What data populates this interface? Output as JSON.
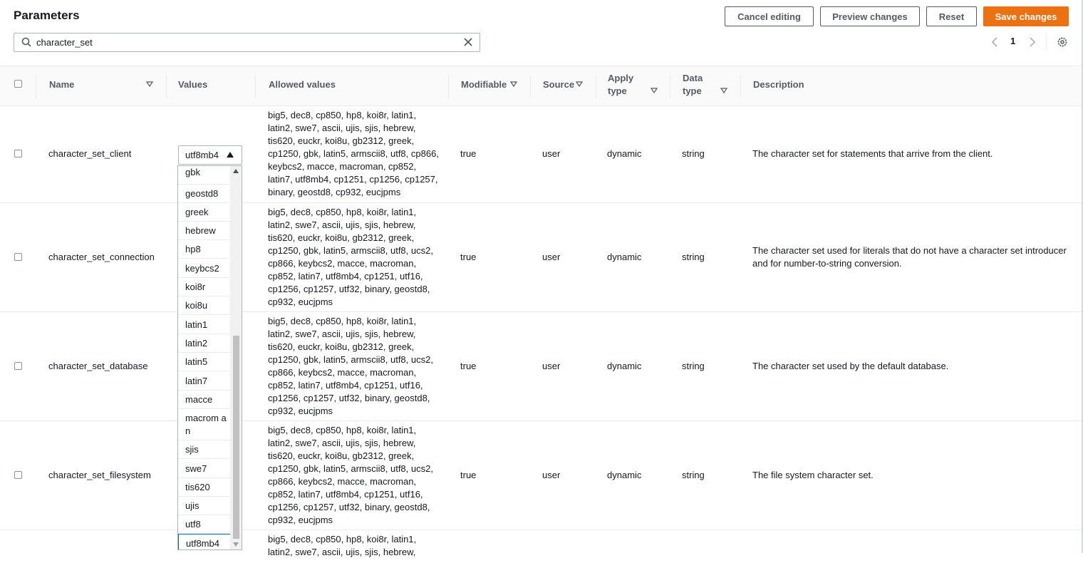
{
  "header": {
    "title": "Parameters",
    "buttons": {
      "cancel": "Cancel editing",
      "preview": "Preview changes",
      "reset": "Reset",
      "save": "Save changes"
    }
  },
  "search": {
    "value": "character_set"
  },
  "pagination": {
    "page": "1"
  },
  "columns": {
    "name": "Name",
    "values": "Values",
    "allowed": "Allowed values",
    "modifiable": "Modifiable",
    "source": "Source",
    "apply_type": "Apply\ntype",
    "data_type": "Data\ntype",
    "description": "Description"
  },
  "rows": [
    {
      "name": "character_set_client",
      "allowed": "big5, dec8, cp850, hp8, koi8r, latin1, latin2, swe7, ascii, ujis, sjis, hebrew, tis620, euckr, koi8u, gb2312, greek, cp1250, gbk, latin5, armscii8, utf8, cp866, keybcs2, macce, macroman, cp852, latin7, utf8mb4, cp1251, cp1256, cp1257, binary, geostd8, cp932, eucjpms",
      "modifiable": "true",
      "source": "user",
      "apply_type": "dynamic",
      "data_type": "string",
      "description": "The character set for statements that arrive from the client."
    },
    {
      "name": "character_set_connection",
      "allowed": "big5, dec8, cp850, hp8, koi8r, latin1, latin2, swe7, ascii, ujis, sjis, hebrew, tis620, euckr, koi8u, gb2312, greek, cp1250, gbk, latin5, armscii8, utf8, ucs2, cp866, keybcs2, macce, macroman, cp852, latin7, utf8mb4, cp1251, utf16, cp1256, cp1257, utf32, binary, geostd8, cp932, eucjpms",
      "modifiable": "true",
      "source": "user",
      "apply_type": "dynamic",
      "data_type": "string",
      "description": "The character set used for literals that do not have a character set introducer and for number-to-string conversion."
    },
    {
      "name": "character_set_database",
      "allowed": "big5, dec8, cp850, hp8, koi8r, latin1, latin2, swe7, ascii, ujis, sjis, hebrew, tis620, euckr, koi8u, gb2312, greek, cp1250, gbk, latin5, armscii8, utf8, ucs2, cp866, keybcs2, macce, macroman, cp852, latin7, utf8mb4, cp1251, utf16, cp1256, cp1257, utf32, binary, geostd8, cp932, eucjpms",
      "modifiable": "true",
      "source": "user",
      "apply_type": "dynamic",
      "data_type": "string",
      "description": "The character set used by the default database."
    },
    {
      "name": "character_set_filesystem",
      "allowed": "big5, dec8, cp850, hp8, koi8r, latin1, latin2, swe7, ascii, ujis, sjis, hebrew, tis620, euckr, koi8u, gb2312, greek, cp1250, gbk, latin5, armscii8, utf8, ucs2, cp866, keybcs2, macce, macroman, cp852, latin7, utf8mb4, cp1251, utf16, cp1256, cp1257, utf32, binary, geostd8, cp932, eucjpms",
      "modifiable": "true",
      "source": "user",
      "apply_type": "dynamic",
      "data_type": "string",
      "description": "The file system character set."
    },
    {
      "name": "",
      "allowed": "big5, dec8, cp850, hp8, koi8r, latin1, latin2, swe7, ascii, ujis, sjis, hebrew,",
      "modifiable": "",
      "source": "",
      "apply_type": "",
      "data_type": "",
      "description": ""
    }
  ],
  "select": {
    "value": "utf8mb4"
  },
  "dropdown_options": [
    "gbk",
    "geostd8",
    "greek",
    "hebrew",
    "hp8",
    "keybcs2",
    "koi8r",
    "koi8u",
    "latin1",
    "latin2",
    "latin5",
    "latin7",
    "macce",
    "macroman",
    "sjis",
    "swe7",
    "tis620",
    "ujis",
    "utf8",
    "utf8mb4"
  ],
  "colors": {
    "primary": "#ec7211",
    "text": "#16191f",
    "muted": "#545b64"
  }
}
